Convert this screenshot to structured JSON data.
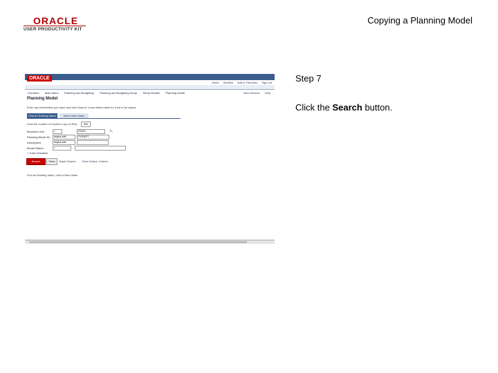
{
  "header": {
    "logo_word": "ORACLE",
    "logo_sub": "USER PRODUCTIVITY KIT",
    "doc_title": "Copying a Planning Model"
  },
  "screenshot": {
    "logo": "ORACLE",
    "top_links": [
      "Home",
      "Worklist",
      "Add to Favorites",
      "Sign out"
    ],
    "nav_items": [
      "Favorites",
      "Main Menu",
      "Planning and Budgeting",
      "Planning and Budgeting Setup",
      "Setup Models",
      "Planning Model"
    ],
    "tools": [
      "New Window",
      "Help"
    ],
    "page_title": "Planning Model",
    "instructions": "Enter any information you have and click Search. Leave fields blank for a list of all values.",
    "tabs": [
      "Find an Existing Value",
      "Add a New Value"
    ],
    "limit_label": "Limit the number of results to (up to 300):",
    "limit_value": "300",
    "fields": [
      {
        "label": "Business Unit:",
        "op": "=",
        "value": "FSU01"
      },
      {
        "label": "Planning Model ID:",
        "op": "begins with",
        "value": "FY0DEPT"
      },
      {
        "label": "Description:",
        "op": "begins with",
        "value": ""
      },
      {
        "label": "Model Status:",
        "op": "=",
        "value": ""
      }
    ],
    "case_sensitive_label": "Case Sensitive",
    "search_button": "Search",
    "clear_button": "Clear",
    "basic_search_link": "Basic Search",
    "save_criteria_link": "Save Search Criteria",
    "find_links": "Find an Existing Value | Add a New Value"
  },
  "step": {
    "label": "Step 7",
    "instruction_prefix": "Click the ",
    "instruction_bold": "Search",
    "instruction_suffix": " button."
  }
}
